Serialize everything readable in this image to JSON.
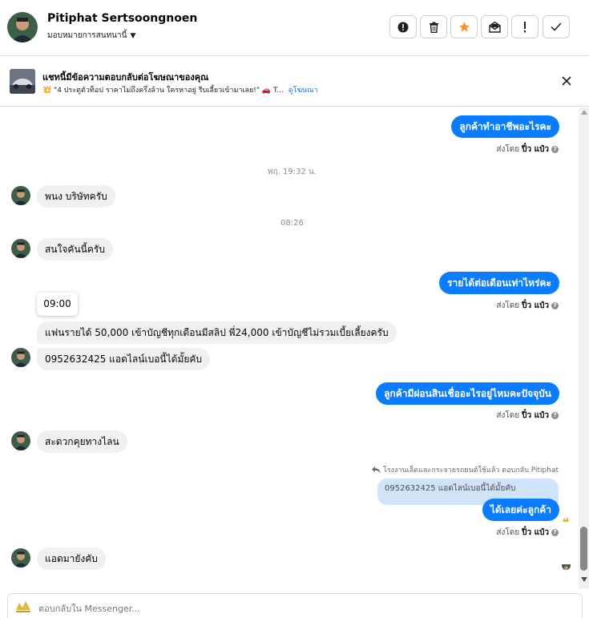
{
  "header": {
    "contact_name": "Pitiphat Sertsoongnoen",
    "assign_label": "มอบหมายการสนทนานี้",
    "buttons": [
      {
        "name": "report-spam-button",
        "icon": "exclamation-circle-icon"
      },
      {
        "name": "delete-button",
        "icon": "trash-icon"
      },
      {
        "name": "star-button",
        "icon": "star-icon"
      },
      {
        "name": "mark-unread-button",
        "icon": "envelope-open-icon"
      },
      {
        "name": "follow-up-button",
        "icon": "exclamation-icon"
      },
      {
        "name": "mark-done-button",
        "icon": "check-icon"
      }
    ]
  },
  "banner": {
    "title": "แชทนี้มีข้อความตอบกลับต่อโฆษณาของคุณ",
    "subtitle": "💥 \"4 ประตูตัวท็อป ราคาไม่ถึงครึ่งล้าน ใครหาอยู่ รีบเลี้ยวเข้ามาเลย!\" 🚗 T...",
    "see_ad": "ดูโฆษณา"
  },
  "messages": {
    "m1": "ลูกค้าทำอาชีพอะไรคะ",
    "sent_by_prefix": "ส่งโดย",
    "sent_by_name": "ปิ๋ว แป๋ว",
    "stamp1": "พฤ. 19:32 น.",
    "m2": "พนง บริษัทครับ",
    "stamp2": "08:26",
    "m3": "สนใจคันนี้ครับ",
    "m4": "รายได้ต่อเดือนเท่าไหร่คะ",
    "time_tooltip": "09:00",
    "m5": "แฟนรายได้ 50,000 เข้าบัญชีทุกเดือนมีสลิป พี่24,000 เข้าบัญชีไม่รวมเบี้ยเลี้ยงครับ",
    "m6": "0952632425 แอดไลน์เบอนี้ได้มั้ยคับ",
    "m7": "ลูกค้ามีผ่อนสินเชื่ออะไรอยู่ไหมคะปัจจุบัน",
    "m8": "สะดวกคุยทางไลน",
    "reply_note": "โรงงานเล็ดและกระจายรถยนต์ใช้แล้ว ตอบกลับ Pitiphat",
    "reply_quote": "0952632425 แอดไลน์เบอนี้ได้มั้ยคับ",
    "m9": "ได้เลยค่ะลูกค้า",
    "m10": "แอดมายังคับ"
  },
  "composer": {
    "placeholder": "ตอบกลับใน Messenger..."
  }
}
